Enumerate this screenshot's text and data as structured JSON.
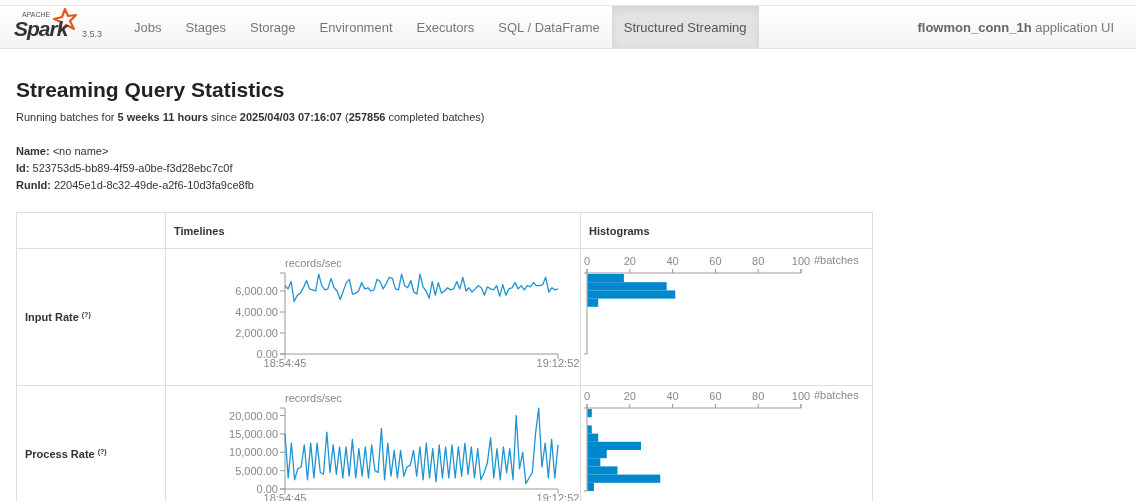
{
  "navbar": {
    "brand": {
      "prefix": "APACHE",
      "name": "Spark"
    },
    "version": "3.5.3",
    "tabs": [
      {
        "label": "Jobs",
        "selected": false
      },
      {
        "label": "Stages",
        "selected": false
      },
      {
        "label": "Storage",
        "selected": false
      },
      {
        "label": "Environment",
        "selected": false
      },
      {
        "label": "Executors",
        "selected": false
      },
      {
        "label": "SQL / DataFrame",
        "selected": false
      },
      {
        "label": "Structured Streaming",
        "selected": true
      }
    ],
    "app_title": "**flowmon_conn_1h** application UI"
  },
  "page": {
    "title": "Streaming Query Statistics",
    "summary": "Running batches for **5 weeks 11 hours** since **2025/04/03 07:16:07** (**257856** completed batches)",
    "details": [
      "**Name:** <no name>",
      "**Id:** 523753d5-bb89-4f59-a0be-f3d28ebc7c0f",
      "**RunId:** 22045e1d-8c32-49de-a2f6-10d3fa9ce8fb"
    ],
    "table": {
      "columns": [
        "Timelines",
        "Histograms"
      ],
      "rows": [
        {
          "label": "Input Rate",
          "help": "(?)",
          "timeline": {
            "start_time": "18:54:45",
            "end_time": "19:12:52",
            "chart_data": {
              "type": "line",
              "ylabel": "records/sec",
              "ylim": [
                0,
                7714
              ],
              "yticks": [
                {
                  "value": 0,
                  "label": "0.00"
                },
                {
                  "value": 2000,
                  "label": "2,000.00"
                },
                {
                  "value": 4000,
                  "label": "4,000.00"
                },
                {
                  "value": 6000,
                  "label": "6,000.00"
                }
              ],
              "series": [
                {
                  "color": "#1f94d2",
                  "values": [
                    6500,
                    6200,
                    6900,
                    5000,
                    5600,
                    5800,
                    6300,
                    7000,
                    6200,
                    6100,
                    6000,
                    7600,
                    6500,
                    6100,
                    6200,
                    7200,
                    6300,
                    6000,
                    5200,
                    6000,
                    6800,
                    7100,
                    5700,
                    5800,
                    6000,
                    6800,
                    6200,
                    6300,
                    6000,
                    6100,
                    7100,
                    6900,
                    6200,
                    6700,
                    7300,
                    7200,
                    6200,
                    6100,
                    7600,
                    6500,
                    6300,
                    7000,
                    5900,
                    5700,
                    7600,
                    6400,
                    6000,
                    5300,
                    6900,
                    5600,
                    6800,
                    5800,
                    6000,
                    6300,
                    6100,
                    6200,
                    6900,
                    6200,
                    7300,
                    6000,
                    6300,
                    5900,
                    6200,
                    6500,
                    6300,
                    5600,
                    6400,
                    6200,
                    6100,
                    6500,
                    5500,
                    6600,
                    5600,
                    6200,
                    6300,
                    6800,
                    6200,
                    6500,
                    6100,
                    6500,
                    6400,
                    6800,
                    6500,
                    6500,
                    6600,
                    7300,
                    5900,
                    6300,
                    6100,
                    6200
                  ]
                }
              ]
            }
          },
          "histogram": {
            "chart_data": {
              "type": "bar",
              "orientation": "horizontal",
              "xlabel": "#batches",
              "xlim": [
                0,
                100
              ],
              "xticks": [
                0,
                20,
                40,
                60,
                80,
                100
              ],
              "series": [
                {
                  "color": "#0088cc",
                  "values": [
                    17,
                    37,
                    41,
                    5
                  ]
                }
              ]
            }
          }
        },
        {
          "label": "Process Rate",
          "help": "(?)",
          "timeline": {
            "start_time": "18:54:45",
            "end_time": "19:12:52",
            "chart_data": {
              "type": "line",
              "ylabel": "records/sec",
              "ylim": [
                0,
                22050
              ],
              "yticks": [
                {
                  "value": 0,
                  "label": "0.00"
                },
                {
                  "value": 5000,
                  "label": "5,000.00"
                },
                {
                  "value": 10000,
                  "label": "10,000.00"
                },
                {
                  "value": 15000,
                  "label": "15,000.00"
                },
                {
                  "value": 20000,
                  "label": "20,000.00"
                }
              ],
              "series": [
                {
                  "color": "#1f94d2",
                  "values": [
                    15000,
                    3000,
                    12500,
                    2500,
                    5500,
                    6000,
                    12000,
                    2500,
                    12500,
                    3000,
                    12500,
                    4500,
                    4000,
                    15500,
                    4500,
                    12000,
                    4000,
                    11500,
                    3000,
                    11500,
                    3500,
                    13500,
                    3000,
                    11000,
                    3500,
                    11500,
                    3000,
                    12000,
                    5000,
                    4500,
                    16500,
                    2500,
                    12500,
                    3500,
                    10500,
                    3000,
                    10500,
                    3500,
                    6000,
                    6500,
                    10500,
                    3500,
                    11500,
                    2500,
                    12500,
                    3000,
                    11000,
                    2000,
                    12000,
                    3000,
                    11500,
                    3000,
                    12000,
                    3000,
                    11500,
                    3500,
                    12500,
                    4000,
                    11500,
                    3000,
                    11000,
                    2500,
                    4500,
                    7000,
                    14000,
                    3000,
                    11000,
                    2500,
                    11500,
                    4500,
                    11000,
                    2500,
                    20000,
                    5500,
                    10000,
                    1500,
                    3000,
                    4500,
                    15000,
                    22000,
                    6000,
                    12500,
                    3000,
                    13500,
                    3000,
                    12000
                  ]
                }
              ]
            }
          },
          "histogram": {
            "chart_data": {
              "type": "bar",
              "orientation": "horizontal",
              "xlabel": "#batches",
              "xlim": [
                0,
                100
              ],
              "xticks": [
                0,
                20,
                40,
                60,
                80,
                100
              ],
              "series": [
                {
                  "color": "#0088cc",
                  "values": [
                    2,
                    0,
                    2,
                    5,
                    25,
                    9,
                    6,
                    14,
                    34,
                    3
                  ]
                }
              ]
            }
          }
        }
      ]
    }
  }
}
